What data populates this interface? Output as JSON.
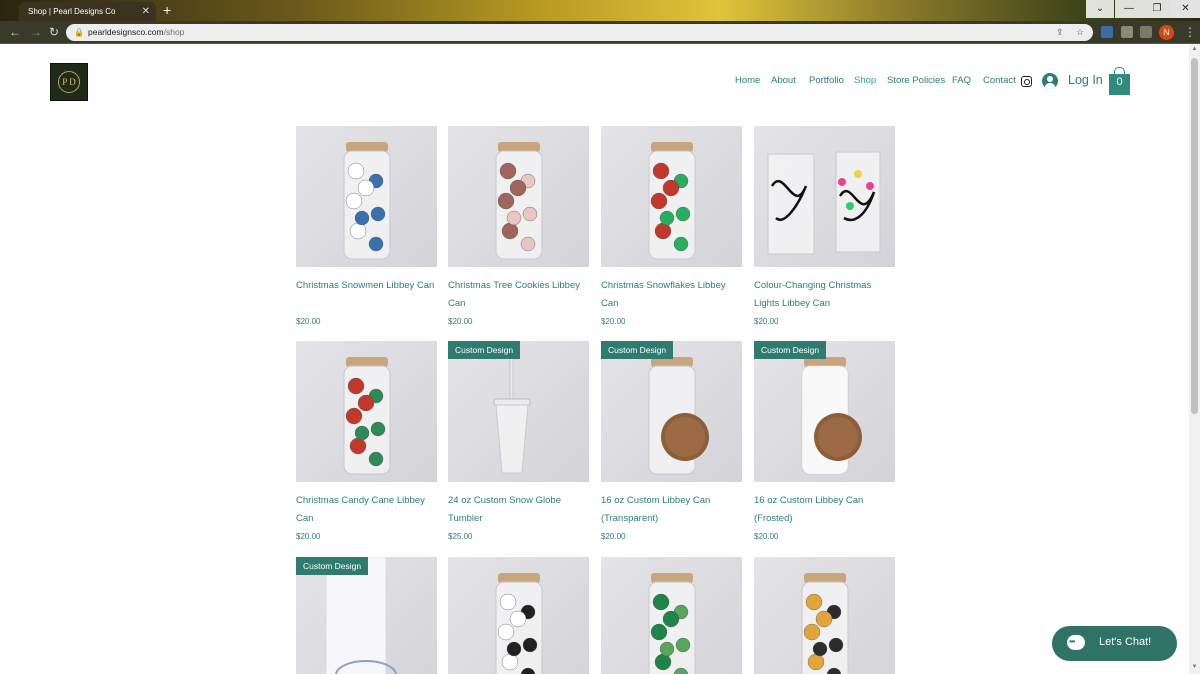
{
  "browser": {
    "tab_title": "Shop | Pearl Designs Co",
    "tab_close": "✕",
    "new_tab": "+",
    "window_buttons": [
      "⌄",
      "—",
      "❐",
      "✕"
    ],
    "url_domain": "pearldesignsco.com",
    "url_path": "/shop",
    "profile_initial": "N"
  },
  "site": {
    "logo_text": "P D",
    "nav": [
      "Home",
      "About",
      "Portfolio",
      "Shop",
      "Store Policies",
      "FAQ",
      "Contact"
    ],
    "active_nav": "Shop",
    "login_label": "Log In",
    "cart_count": "0"
  },
  "products": [
    {
      "name": "Christmas Snowmen Libbey Can",
      "price": "$20.00",
      "ribbon": "",
      "motif": "snowmen"
    },
    {
      "name": "Christmas Tree Cookies Libbey Can",
      "price": "$20.00",
      "ribbon": "",
      "motif": "cookies"
    },
    {
      "name": "Christmas Snowflakes Libbey Can",
      "price": "$20.00",
      "ribbon": "",
      "motif": "snowflakes"
    },
    {
      "name": "Colour-Changing Christmas Lights Libbey Can",
      "price": "$20.00",
      "ribbon": "",
      "motif": "lights"
    },
    {
      "name": "Christmas Candy Cane Libbey Can",
      "price": "$20.00",
      "ribbon": "",
      "motif": "candycane"
    },
    {
      "name": "24 oz Custom Snow Globe Tumbler",
      "price": "$25.00",
      "ribbon": "Custom Design",
      "motif": "tumbler"
    },
    {
      "name": "16 oz Custom Libbey Can (Transparent)",
      "price": "$20.00",
      "ribbon": "Custom Design",
      "motif": "clear"
    },
    {
      "name": "16 oz Custom Libbey Can (Frosted)",
      "price": "$20.00",
      "ribbon": "Custom Design",
      "motif": "frosted"
    },
    {
      "name": "",
      "price": "",
      "ribbon": "Custom Design",
      "motif": "white-tumbler"
    },
    {
      "name": "",
      "price": "",
      "ribbon": "",
      "motif": "ghosts"
    },
    {
      "name": "",
      "price": "",
      "ribbon": "",
      "motif": "monstera-green"
    },
    {
      "name": "",
      "price": "",
      "ribbon": "",
      "motif": "monstera-gold"
    }
  ],
  "chat": {
    "label": "Let's Chat!"
  },
  "colors": {
    "accent": "#2b7e78",
    "ribbon": "#2f7b70",
    "chat": "#2f7266"
  }
}
